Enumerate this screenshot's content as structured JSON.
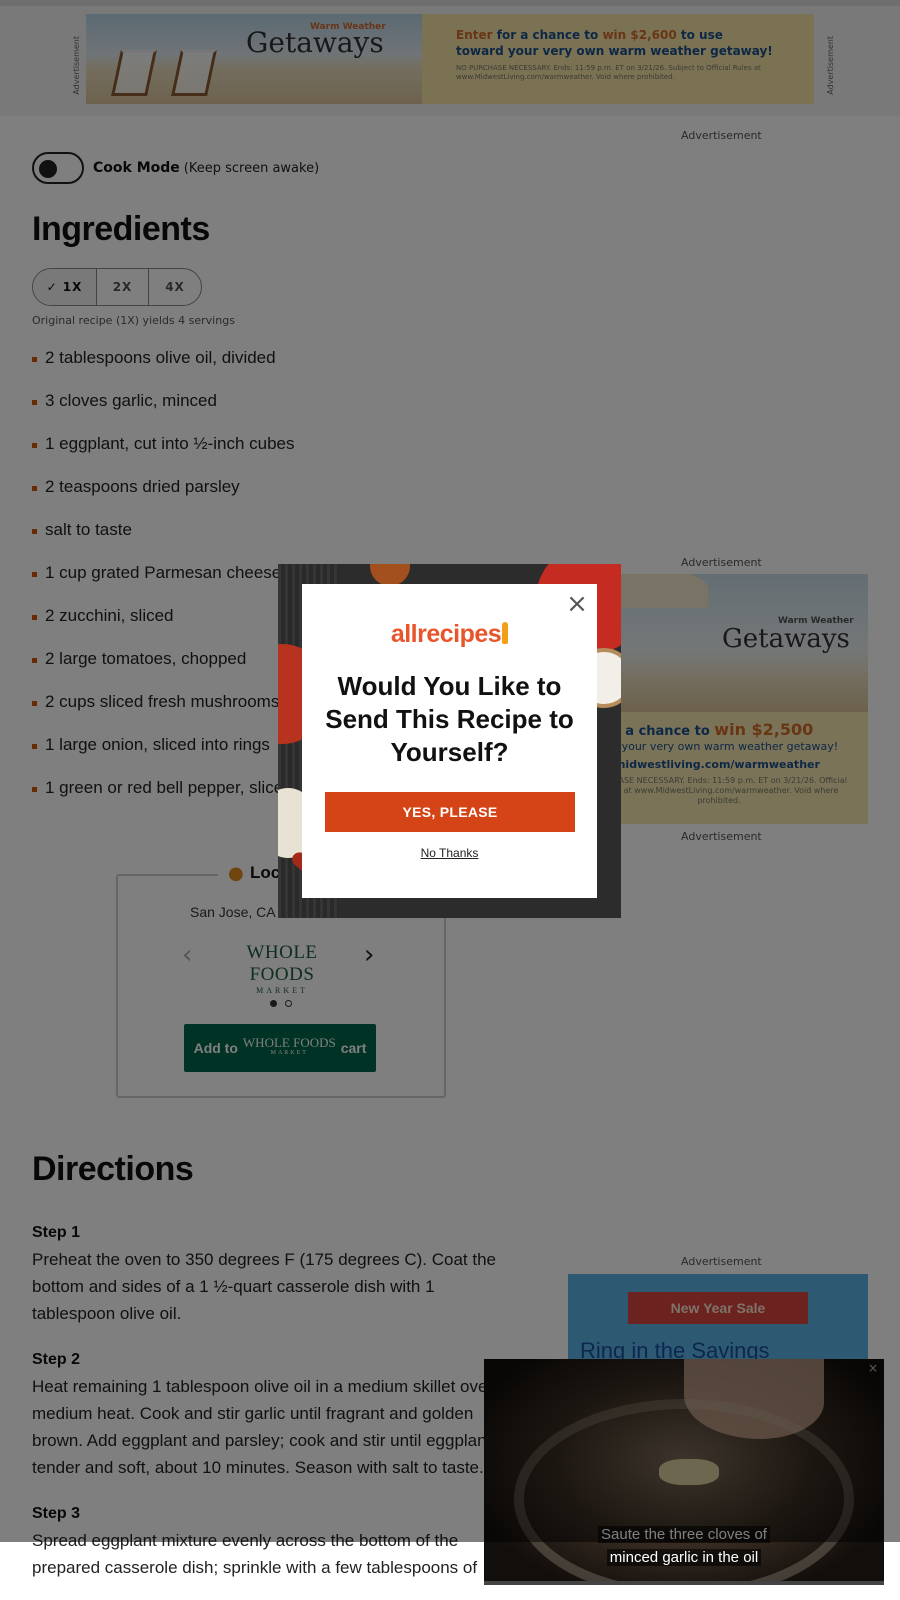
{
  "top_ad": {
    "side_label": "Advertisement",
    "kicker": "Warm Weather",
    "headline": "Getaways",
    "line1_pre": "Enter",
    "line1_mid": " for a chance to ",
    "line1_amount": "win $2,600",
    "line1_post": " to use",
    "line2": "toward your very own warm weather getaway!",
    "fine_print": "NO PURCHASE NECESSARY. Ends: 11:59 p.m. ET on 3/21/26. Subject to Official Rules at www.MidwestLiving.com/warmweather. Void where prohibited."
  },
  "ad_label": "Advertisement",
  "cook_mode": {
    "label": "Cook Mode",
    "sub": "(Keep screen awake)"
  },
  "ingredients": {
    "heading": "Ingredients",
    "scale_options": [
      "✓ 1X",
      "2X",
      "4X"
    ],
    "yield_note": "Original recipe (1X) yields 4 servings",
    "items": [
      "2 tablespoons olive oil, divided",
      "3 cloves garlic, minced",
      "1 eggplant, cut into ½-inch cubes",
      "2 teaspoons dried parsley",
      "salt to taste",
      "1 cup grated Parmesan cheese",
      "2 zucchini, sliced",
      "2 large tomatoes, chopped",
      "2 cups sliced fresh mushrooms",
      "1 large onion, sliced into rings",
      "1 green or red bell pepper, sliced"
    ]
  },
  "store": {
    "title": "Loc",
    "location": "San Jose, CA",
    "brand": "WHOLE FOODS",
    "brand_sub": "MARKET",
    "cart_pre": "Add to",
    "cart_post": "cart"
  },
  "side_ad": {
    "kicker": "Warm Weather",
    "headline": "Getaways",
    "line1": "er for a chance to ",
    "amount": "win $2,500",
    "line2": "toward your very own warm weather getaway!",
    "line3": "www.midwestliving.com/warmweather",
    "fine_print": "PURCHASE NECESSARY. Ends: 11:59 p.m. ET on 3/21/26. Official Rules at www.MidwestLiving.com/warmweather. Void where prohibited."
  },
  "directions": {
    "heading": "Directions",
    "steps": [
      {
        "title": "Step 1",
        "text": "Preheat the oven to 350 degrees F (175 degrees C). Coat the bottom and sides of a 1 ½-quart casserole dish with 1 tablespoon olive oil."
      },
      {
        "title": "Step 2",
        "text": "Heat remaining 1 tablespoon olive oil in a medium skillet over medium heat. Cook and stir garlic until fragrant and golden brown. Add eggplant and parsley; cook and stir until eggplant is tender and soft, about 10 minutes. Season with salt to taste."
      },
      {
        "title": "Step 3",
        "text": "Spread eggplant mixture evenly across the bottom of the prepared casserole dish; sprinkle with a few tablespoons of"
      }
    ]
  },
  "sale_ad": {
    "ribbon": "New Year Sale",
    "headline": "Ring in the Savings"
  },
  "video": {
    "caption1": "Saute the three cloves of",
    "caption2": "minced garlic in the oil",
    "close": "×"
  },
  "modal": {
    "logo": "allrecipes",
    "question": "Would You Like to Send This Recipe to Yourself?",
    "yes": "YES, PLEASE",
    "no": "No Thanks",
    "close": "×"
  }
}
